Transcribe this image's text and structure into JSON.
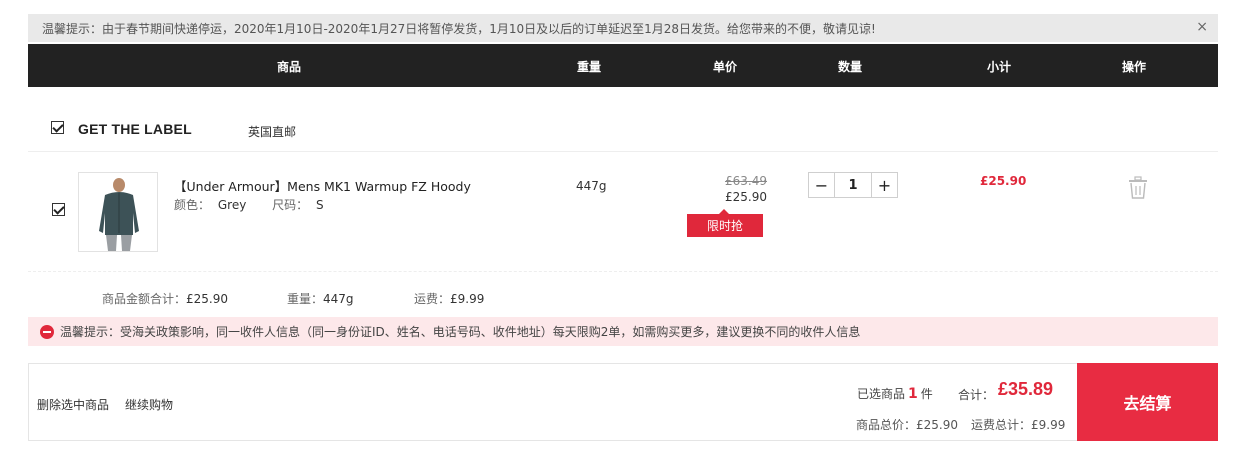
{
  "notice": {
    "text": "温馨提示：由于春节期间快递停运，2020年1月10日-2020年1月27日将暂停发货，1月10日及以后的订单延迟至1月28日发货。给您带来的不便，敬请见谅!",
    "close": "×"
  },
  "table_header": {
    "product": "商品",
    "weight": "重量",
    "unit_price": "单价",
    "quantity": "数量",
    "subtotal": "小计",
    "action": "操作"
  },
  "shop": {
    "name": "GET THE LABEL",
    "tag": "英国直邮"
  },
  "item": {
    "name": "【Under Armour】Mens MK1 Warmup FZ Hoody",
    "color_label": "颜色：",
    "color": "Grey",
    "size_label": "尺码：",
    "size": "S",
    "weight": "447g",
    "original_price": "£63.49",
    "price": "£25.90",
    "flash_label": "限时抢",
    "quantity": "1",
    "minus": "−",
    "plus": "+",
    "subtotal": "£25.90"
  },
  "summary": {
    "amount_label": "商品金额合计：",
    "amount": "£25.90",
    "weight_label": "重量：",
    "weight": "447g",
    "shipping_label": "运费：",
    "shipping": "£9.99"
  },
  "warning": {
    "text": "温馨提示：受海关政策影响，同一收件人信息（同一身份证ID、姓名、电话号码、收件地址）每天限购2单，如需购买更多，建议更换不同的收件人信息"
  },
  "footer": {
    "delete_selected": "删除选中商品",
    "continue_shopping": "继续购物",
    "selected_prefix": "已选商品",
    "selected_count": "1",
    "selected_suffix": "件",
    "total_label": "合计：",
    "total": "£35.89",
    "goods_total_label": "商品总价：",
    "goods_total": "£25.90",
    "shipping_total_label": "运费总计：",
    "shipping_total": "£9.99",
    "checkout": "去结算"
  },
  "colors": {
    "accent_red": "#e0283b",
    "header_dark": "#222222",
    "notice_bg": "#e9e9e9",
    "warning_bg": "#fde8ea"
  }
}
